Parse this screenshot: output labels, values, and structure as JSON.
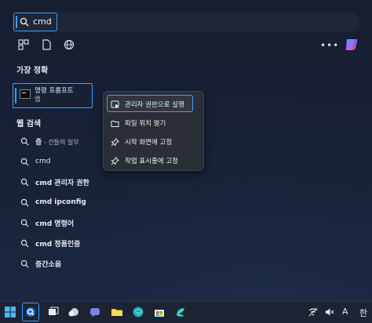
{
  "search": {
    "query": "cmd"
  },
  "sections": {
    "best_match": "가장 정확",
    "web_search": "웹 검색"
  },
  "best_match": {
    "label": "명령 프롬프트",
    "sublabel": "앱"
  },
  "web_results": [
    {
      "term": "층",
      "suffix": " - 건들의 일부"
    },
    {
      "term": "cmd",
      "suffix": ""
    },
    {
      "term": "cmd 관리자 권한",
      "suffix": ""
    },
    {
      "term": "cmd ipconfig",
      "suffix": ""
    },
    {
      "term": "cmd 명령어",
      "suffix": ""
    },
    {
      "term": "cmd 정품인증",
      "suffix": ""
    },
    {
      "term": "증간소음",
      "suffix": ""
    }
  ],
  "context_menu": {
    "items": [
      {
        "label": "관리자 권한으로 실행",
        "icon": "shield-run-icon"
      },
      {
        "label": "파일 위치 열기",
        "icon": "folder-icon"
      },
      {
        "label": "시작 화면에 고정",
        "icon": "pin-icon"
      },
      {
        "label": "작업 표시줄에 고정",
        "icon": "pin-icon"
      }
    ]
  },
  "topbar": {
    "more": "•••"
  },
  "tray": {
    "input_indicator": "A",
    "ime": "한"
  },
  "colors": {
    "accent": "#3aa0ff",
    "menu_bg": "#2a2e37",
    "taskbar_bg": "#1c2333"
  }
}
